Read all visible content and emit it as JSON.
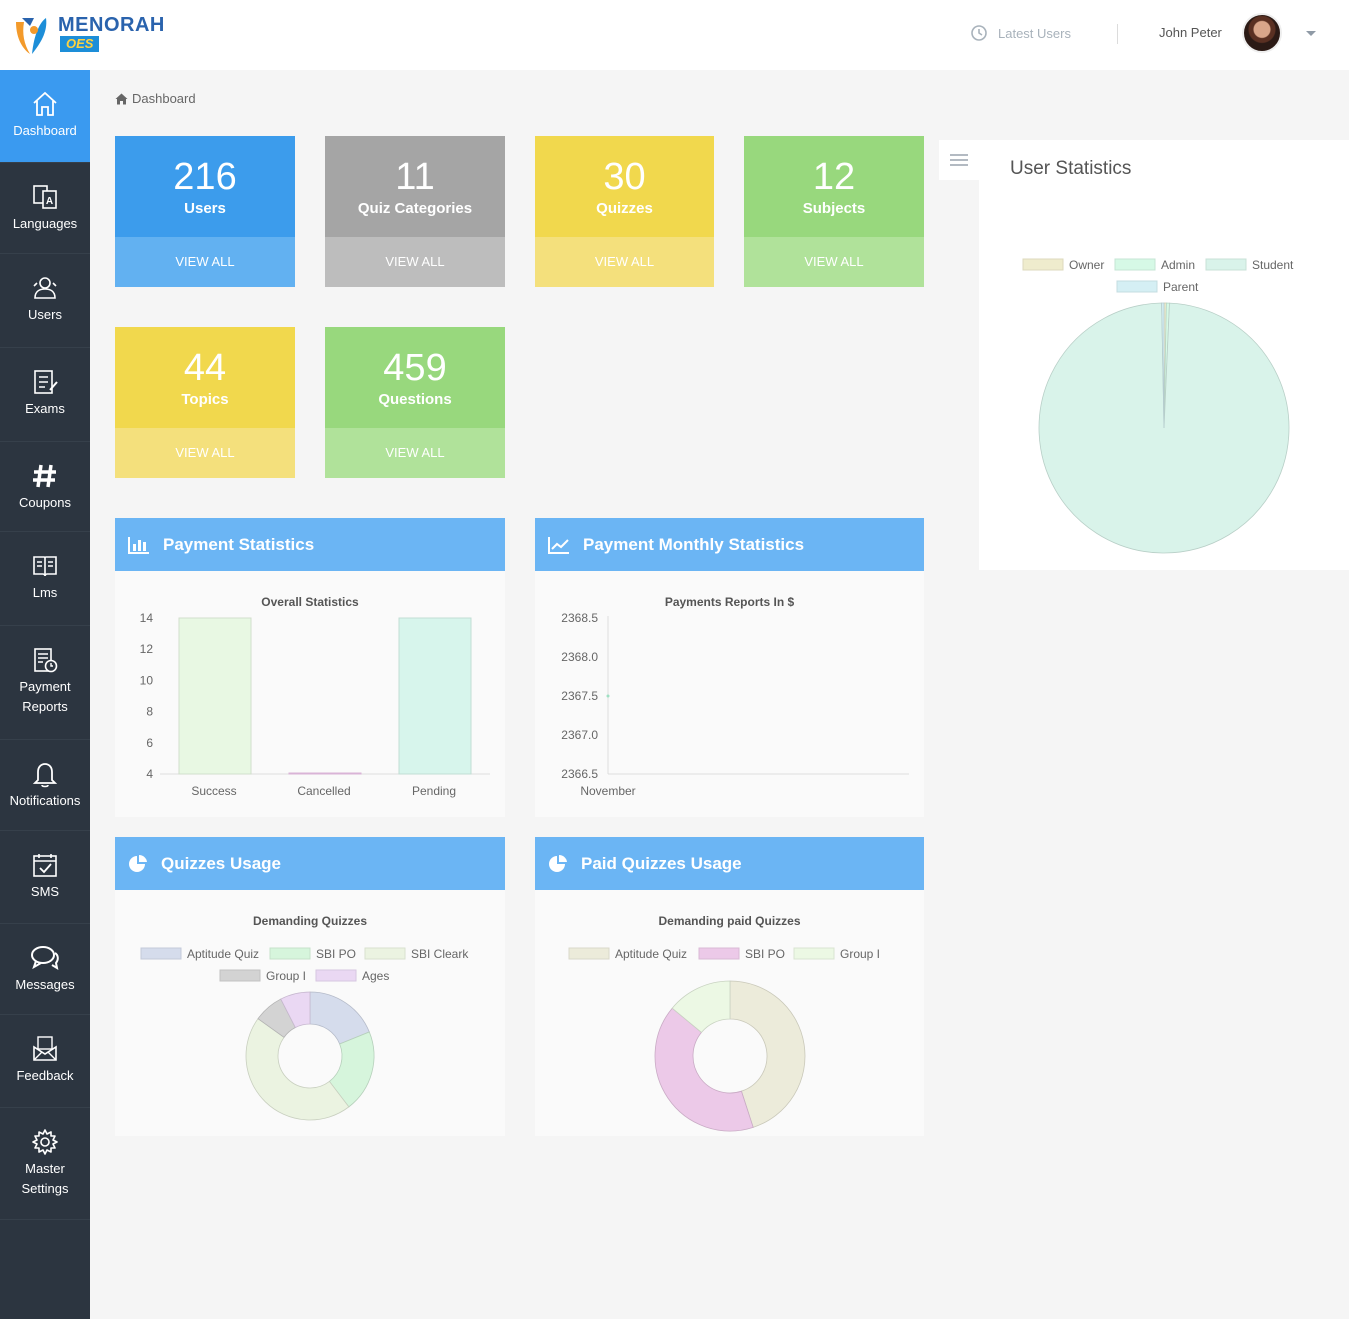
{
  "header": {
    "logo_text": "MENORAH",
    "logo_sub": "OES",
    "latest_users": "Latest Users",
    "user_name": "John Peter"
  },
  "sidebar": {
    "items": [
      {
        "label": "Dashboard",
        "icon": "home-icon"
      },
      {
        "label": "Languages",
        "icon": "translate-icon"
      },
      {
        "label": "Users",
        "icon": "users-icon"
      },
      {
        "label": "Exams",
        "icon": "checklist-icon"
      },
      {
        "label": "Coupons",
        "icon": "hash-icon"
      },
      {
        "label": "Lms",
        "icon": "book-icon"
      },
      {
        "label": "Payment Reports",
        "icon": "report-clock-icon"
      },
      {
        "label": "Notifications",
        "icon": "bell-icon"
      },
      {
        "label": "SMS",
        "icon": "calendar-check-icon"
      },
      {
        "label": "Messages",
        "icon": "chat-icon"
      },
      {
        "label": "Feedback",
        "icon": "envelope-icon"
      },
      {
        "label": "Master Settings",
        "icon": "gear-icon"
      }
    ]
  },
  "breadcrumb": {
    "label": "Dashboard"
  },
  "cards": [
    {
      "value": "216",
      "label": "Users",
      "action": "VIEW ALL"
    },
    {
      "value": "11",
      "label": "Quiz Categories",
      "action": "VIEW ALL"
    },
    {
      "value": "30",
      "label": "Quizzes",
      "action": "VIEW ALL"
    },
    {
      "value": "12",
      "label": "Subjects",
      "action": "VIEW ALL"
    },
    {
      "value": "44",
      "label": "Topics",
      "action": "VIEW ALL"
    },
    {
      "value": "459",
      "label": "Questions",
      "action": "VIEW ALL"
    }
  ],
  "panels": {
    "payment_statistics": "Payment Statistics",
    "payment_monthly": "Payment Monthly Statistics",
    "quizzes_usage": "Quizzes Usage",
    "paid_quizzes_usage": "Paid Quizzes Usage"
  },
  "user_statistics": {
    "title": "User Statistics"
  },
  "chart_data": [
    {
      "type": "bar",
      "title": "Overall Statistics",
      "categories": [
        "Success",
        "Cancelled",
        "Pending"
      ],
      "values": [
        14,
        4,
        14
      ],
      "colors": [
        "#e8f8e3",
        "#f1c8ef",
        "#d7f5ec"
      ],
      "ylim": [
        4,
        14
      ],
      "yticks": [
        "14",
        "12",
        "10",
        "8",
        "6",
        "4"
      ]
    },
    {
      "type": "line",
      "title": "Payments Reports In $",
      "categories": [
        "November"
      ],
      "values": [
        2367.5
      ],
      "ylim": [
        2366.5,
        2368.5
      ],
      "yticks": [
        "2368.5",
        "2368.0",
        "2367.5",
        "2367.0",
        "2366.5"
      ]
    },
    {
      "type": "pie",
      "title": "Demanding Quizzes",
      "labels": [
        "Aptitude Quiz",
        "SBI PO",
        "SBI Cleark",
        "Group I",
        "Ages"
      ],
      "values": [
        10,
        11,
        24,
        4,
        4
      ],
      "colors": [
        "#d5dcec",
        "#d6f5dc",
        "#ebf3e1",
        "#d3d3d3",
        "#ead8f3"
      ]
    },
    {
      "type": "pie",
      "title": "Demanding paid Quizzes",
      "labels": [
        "Aptitude Quiz",
        "SBI PO",
        "Group I"
      ],
      "values": [
        45,
        41,
        14
      ],
      "colors": [
        "#ecebda",
        "#ecc9e8",
        "#ecf8e4"
      ]
    },
    {
      "type": "pie",
      "title": "",
      "labels": [
        "Owner",
        "Admin",
        "Student",
        "Parent"
      ],
      "values": [
        0.3,
        0.4,
        99,
        0.3
      ],
      "colors": [
        "#efeccd",
        "#d6f9e6",
        "#d9f3ea",
        "#d5eff4"
      ]
    }
  ]
}
